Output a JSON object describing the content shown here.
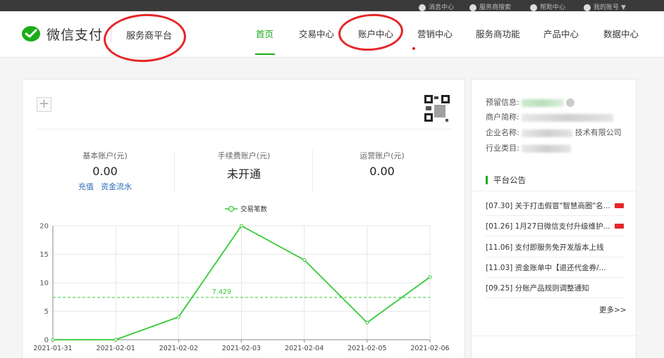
{
  "topbar": {
    "items": [
      "消息中心",
      "服务商搜索",
      "帮助中心",
      "我的账号"
    ]
  },
  "header": {
    "logo_text": "微信支付",
    "platform": "服务商平台",
    "nav": [
      "首页",
      "交易中心",
      "账户中心",
      "营销中心",
      "服务商功能",
      "产品中心",
      "数据中心"
    ],
    "active_nav": "首页"
  },
  "accounts": [
    {
      "label": "基本账户(元)",
      "value": "0.00",
      "links": [
        "充值",
        "资金流水"
      ]
    },
    {
      "label": "手续费账户(元)",
      "value": "未开通",
      "links": []
    },
    {
      "label": "运营账户(元)",
      "value": "0.00",
      "links": []
    }
  ],
  "chart_data": {
    "type": "line",
    "x": [
      "2021-01-31",
      "2021-02-01",
      "2021-02-02",
      "2021-02-03",
      "2021-02-04",
      "2021-02-05",
      "2021-02-06"
    ],
    "series": [
      {
        "name": "交易笔数",
        "values": [
          0,
          0,
          4,
          20,
          14,
          3,
          11
        ]
      }
    ],
    "average_line": {
      "value": 7.429,
      "label": "7.429"
    },
    "ylim": [
      0,
      20
    ],
    "yticks": [
      0,
      5,
      10,
      15,
      20
    ],
    "legend": "top-center",
    "grid": true,
    "color": "#35c935"
  },
  "side": {
    "info": [
      {
        "label": "预留信息:"
      },
      {
        "label": "商户简称:"
      },
      {
        "label": "企业名称:",
        "partial": "技术有限公司"
      },
      {
        "label": "行业类目:"
      }
    ],
    "notice_title": "平台公告",
    "notices": [
      {
        "text": "[07.30] 关于打击假冒\"智慧商圈\"名...",
        "badge": true
      },
      {
        "text": "[01.26] 1月27日微信支付升级维护...",
        "badge": true
      },
      {
        "text": "[11.06] 支付即服务免开发版本上线",
        "badge": false
      },
      {
        "text": "[11.03] 资金账单中【退还代金券/...",
        "badge": false
      },
      {
        "text": "[09.25] 分账产品规则调整通知",
        "badge": false
      }
    ],
    "more": "更多>>"
  },
  "colors": {
    "accent": "#1aad19",
    "annotation": "#e5262a",
    "link": "#2b6cb8"
  }
}
